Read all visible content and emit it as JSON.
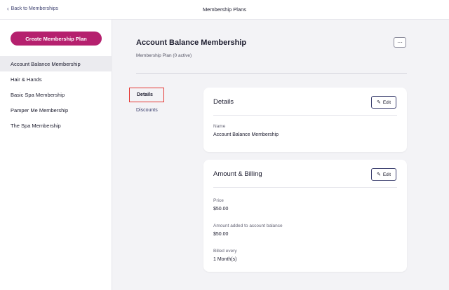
{
  "topbar": {
    "back_label": "Back to Memberships",
    "title": "Membership Plans"
  },
  "sidebar": {
    "create_label": "Create Membership Plan",
    "items": [
      {
        "label": "Account Balance Membership",
        "active": true
      },
      {
        "label": "Hair & Hands",
        "active": false
      },
      {
        "label": "Basic Spa Membership",
        "active": false
      },
      {
        "label": "Pamper Me Membership",
        "active": false
      },
      {
        "label": "The Spa Membership",
        "active": false
      }
    ]
  },
  "plan": {
    "title": "Account Balance Membership",
    "subtitle": "Membership Plan (0 active)",
    "more_label": "···"
  },
  "tabs": {
    "details": "Details",
    "discounts": "Discounts"
  },
  "details_card": {
    "title": "Details",
    "edit_label": "Edit",
    "name_label": "Name",
    "name_value": "Account Balance Membership"
  },
  "billing_card": {
    "title": "Amount & Billing",
    "edit_label": "Edit",
    "price_label": "Price",
    "price_value": "$50.00",
    "added_label": "Amount added to account balance",
    "added_value": "$50.00",
    "billed_label": "Billed every",
    "billed_value": "1 Month(s)"
  },
  "colors": {
    "primary": "#b5206e",
    "highlight": "#e53935",
    "accent": "#3b3f6e"
  }
}
